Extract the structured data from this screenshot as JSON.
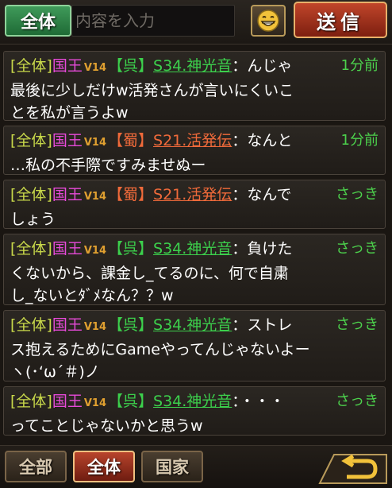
{
  "header": {
    "scope_label": "全体",
    "input_placeholder": "内容を入力",
    "emoji_icon": "smiley-face-icon",
    "send_label": "送信"
  },
  "messages": [
    {
      "scope": "[全体]",
      "title": "国王",
      "vip": "V14",
      "kingdom": "【呉】",
      "kingdom_color": "#3cd04c",
      "sender": "S34.神光音",
      "sep": "：",
      "line1": "んじゃ",
      "line2": "最後に少しだけw活発さんが言いにくいこ",
      "line3": "とを私が言うよw",
      "time": "1分前"
    },
    {
      "scope": "[全体]",
      "title": "国王",
      "vip": "V14",
      "kingdom": "【蜀】",
      "kingdom_color": "#f06a3a",
      "sender": "S21.活発伝",
      "sep": "：",
      "line1": "なんと",
      "line2": "…私の不手際ですみませぬー",
      "line3": "",
      "time": "1分前"
    },
    {
      "scope": "[全体]",
      "title": "国王",
      "vip": "V14",
      "kingdom": "【蜀】",
      "kingdom_color": "#f06a3a",
      "sender": "S21.活発伝",
      "sep": "：",
      "line1": "なんで",
      "line2": "しょう",
      "line3": "",
      "time": "さっき"
    },
    {
      "scope": "[全体]",
      "title": "国王",
      "vip": "V14",
      "kingdom": "【呉】",
      "kingdom_color": "#3cd04c",
      "sender": "S34.神光音",
      "sep": "：",
      "line1": "負けた",
      "line2": "くないから、課金し_てるのに、何で自粛",
      "line3": "し_ないとﾀﾞﾒなん？？w",
      "time": "さっき"
    },
    {
      "scope": "[全体]",
      "title": "国王",
      "vip": "V14",
      "kingdom": "【呉】",
      "kingdom_color": "#3cd04c",
      "sender": "S34.神光音",
      "sep": "：",
      "line1": "ストレ",
      "line2": "ス抱えるためにGameやってんじゃないよー",
      "line3": "ヽ(･‘ω´＃)ノ",
      "time": "さっき"
    },
    {
      "scope": "[全体]",
      "title": "国王",
      "vip": "V14",
      "kingdom": "【呉】",
      "kingdom_color": "#3cd04c",
      "sender": "S34.神光音",
      "sep": "：",
      "line1": "・・・",
      "line2": "ってことじゃないかと思うw",
      "line3": "",
      "time": "さっき"
    }
  ],
  "footer": {
    "tabs": [
      {
        "label": "全部",
        "active": false
      },
      {
        "label": "全体",
        "active": true
      },
      {
        "label": "国家",
        "active": false
      }
    ],
    "back_icon": "return-arrow-icon"
  }
}
